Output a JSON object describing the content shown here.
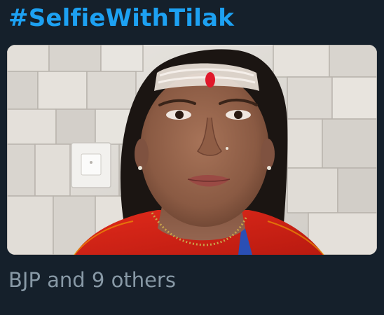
{
  "tweet": {
    "hashtag": "#SelfieWithTilak",
    "tagged_summary": "BJP and 9 others"
  },
  "colors": {
    "background": "#15202b",
    "hashtag": "#1da1f2",
    "secondary_text": "#8899a6"
  }
}
